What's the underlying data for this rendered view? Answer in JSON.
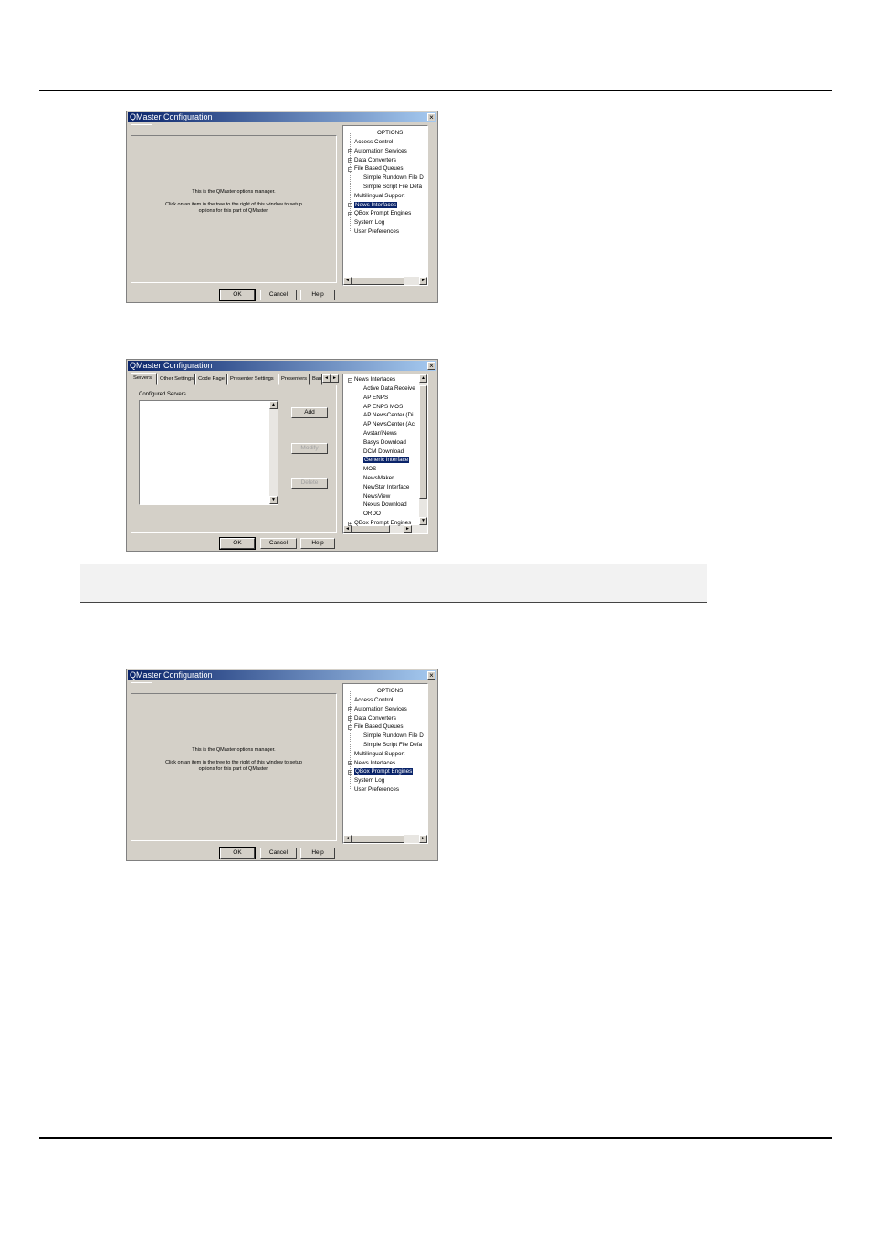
{
  "window_title": "QMaster Configuration",
  "close_glyph": "×",
  "ok_label": "OK",
  "cancel_label": "Cancel",
  "help_label": "Help",
  "welcome_line1": "This is the QMaster options manager.",
  "welcome_line2": "Click on an item in the tree to the right of this window to setup",
  "welcome_line3": "options for this part of QMaster.",
  "scroll_left_glyph": "◄",
  "scroll_right_glyph": "►",
  "scroll_up_glyph": "▲",
  "scroll_down_glyph": "▼",
  "expand_glyph": "+",
  "collapse_glyph": "−",
  "tree1": {
    "root": "OPTIONS",
    "items": [
      {
        "label": "Access Control",
        "toggle": ""
      },
      {
        "label": "Automation Services",
        "toggle": "+"
      },
      {
        "label": "Data Converters",
        "toggle": "+"
      },
      {
        "label": "File Based Queues",
        "toggle": "−"
      },
      {
        "label": "Simple Rundown File D",
        "toggle": ""
      },
      {
        "label": "Simple Script File Defa",
        "toggle": ""
      },
      {
        "label": "Multilingual Support",
        "toggle": ""
      },
      {
        "label": "News Interfaces",
        "toggle": "+",
        "selected": true
      },
      {
        "label": "QBox Prompt Engines",
        "toggle": "+"
      },
      {
        "label": "System Log",
        "toggle": ""
      },
      {
        "label": "User Preferences",
        "toggle": ""
      }
    ]
  },
  "tree3": {
    "root": "OPTIONS",
    "items": [
      {
        "label": "Access Control",
        "toggle": ""
      },
      {
        "label": "Automation Services",
        "toggle": "+"
      },
      {
        "label": "Data Converters",
        "toggle": "+"
      },
      {
        "label": "File Based Queues",
        "toggle": "−"
      },
      {
        "label": "Simple Rundown File D",
        "toggle": ""
      },
      {
        "label": "Simple Script File Defa",
        "toggle": ""
      },
      {
        "label": "Multilingual Support",
        "toggle": ""
      },
      {
        "label": "News Interfaces",
        "toggle": "+"
      },
      {
        "label": "QBox Prompt Engines",
        "toggle": "+",
        "selected": true
      },
      {
        "label": "System Log",
        "toggle": ""
      },
      {
        "label": "User Preferences",
        "toggle": ""
      }
    ]
  },
  "dialog2": {
    "tabs": [
      "Servers",
      "Other Settings",
      "Code Page",
      "Presenter Settings",
      "Presenters",
      "Banu"
    ],
    "configured_servers_label": "Configured Servers",
    "add_label": "Add",
    "modify_label": "Modify",
    "delete_label": "Delete",
    "tree": {
      "parent": "News Interfaces",
      "children": [
        "Active Data Receive",
        "AP ENPS",
        "AP ENPS MOS",
        "AP NewsCenter (Di",
        "AP NewsCenter (Ac",
        "Avstar/iNews",
        "Basys Download",
        "DCM Download",
        "Generic Interface",
        "MOS",
        "NewsMaker",
        "NewStar Interface",
        "NewsView",
        "Nexus Download",
        "ORDO"
      ],
      "selected_child": "Generic Interface",
      "after": "QBox Prompt Engines"
    }
  }
}
